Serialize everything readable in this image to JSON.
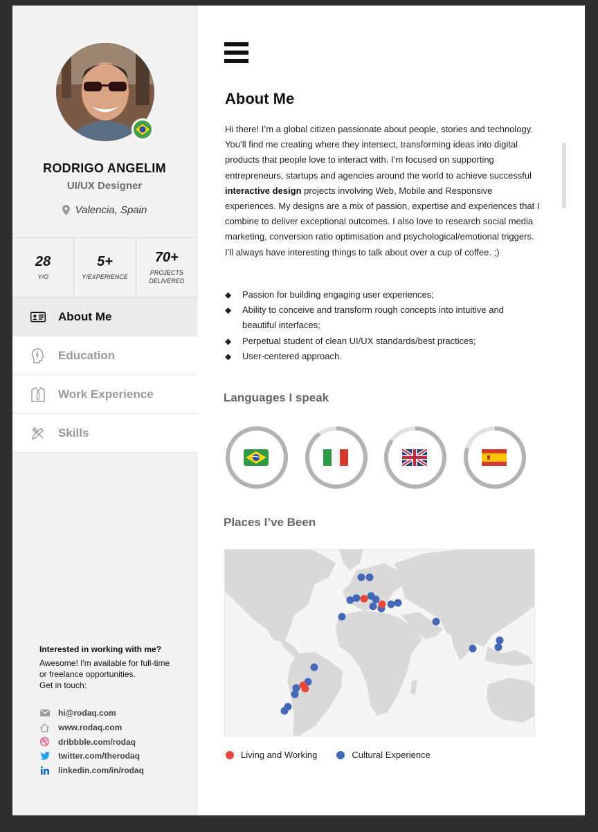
{
  "profile": {
    "name": "RODRIGO ANGELIM",
    "role": "UI/UX Designer",
    "location": "Valencia, Spain"
  },
  "stats": [
    {
      "value": "28",
      "label": "Y/O"
    },
    {
      "value": "5+",
      "label": "Y/EXPERIENCE"
    },
    {
      "value": "70+",
      "label_line1": "PROJECTS",
      "label_line2": "DELIVERED"
    }
  ],
  "nav": [
    {
      "label": "About Me",
      "icon": "id-card-icon",
      "active": true
    },
    {
      "label": "Education",
      "icon": "head-lightbulb-icon",
      "active": false
    },
    {
      "label": "Work Experience",
      "icon": "shirt-tie-icon",
      "active": false
    },
    {
      "label": "Skills",
      "icon": "pencil-ruler-icon",
      "active": false
    }
  ],
  "contact": {
    "title": "Interested in working with me?",
    "line1": "Awesome! I'm available for full-time",
    "line2": "or freelance opportunities.",
    "line3": "Get in touch:",
    "links": [
      {
        "text": "hi@rodaq.com",
        "icon": "mail-icon"
      },
      {
        "text": "www.rodaq.com",
        "icon": "home-icon"
      },
      {
        "text": "dribbble.com/rodaq",
        "icon": "dribbble-icon"
      },
      {
        "text": "twitter.com/therodaq",
        "icon": "twitter-icon"
      },
      {
        "text": "linkedin.com/in/rodaq",
        "icon": "linkedin-icon"
      }
    ]
  },
  "about": {
    "title": "About Me",
    "text_before": "Hi there! I’m a global citizen passionate about people, stories and technology. You’ll find me creating where they intersect, transforming ideas into digital products that people love to interact with. I’m focused on supporting entrepreneurs, startups and agencies around the world to achieve successful ",
    "text_bold": "interactive design",
    "text_after": " projects involving Web, Mobile and Responsive experiences. My designs are a mix of passion, expertise and experiences that I combine to deliver exceptional outcomes. I also love to research social media marketing, conversion ratio optimisation and psychological/emotional triggers. I’ll always have interesting things to talk about over a cup of coffee. ;)",
    "bullets": [
      "Passion for building engaging user experiences;",
      "Ability to conceive and transform rough concepts into intuitive and beautiful interfaces;",
      "Perpetual student of clean UI/UX standards/best practices;",
      "User-centered approach."
    ]
  },
  "languages": {
    "title": "Languages I speak",
    "items": [
      {
        "flag": "brazil-flag",
        "level": 1.0
      },
      {
        "flag": "italy-flag",
        "level": 0.9
      },
      {
        "flag": "uk-flag",
        "level": 0.85
      },
      {
        "flag": "spain-flag",
        "level": 0.8
      }
    ]
  },
  "places": {
    "title": "Places I’ve Been",
    "legend_living": "Living and Working",
    "legend_cultural": "Cultural Experience",
    "color_living": "#e8473c",
    "color_cultural": "#4467b8"
  }
}
